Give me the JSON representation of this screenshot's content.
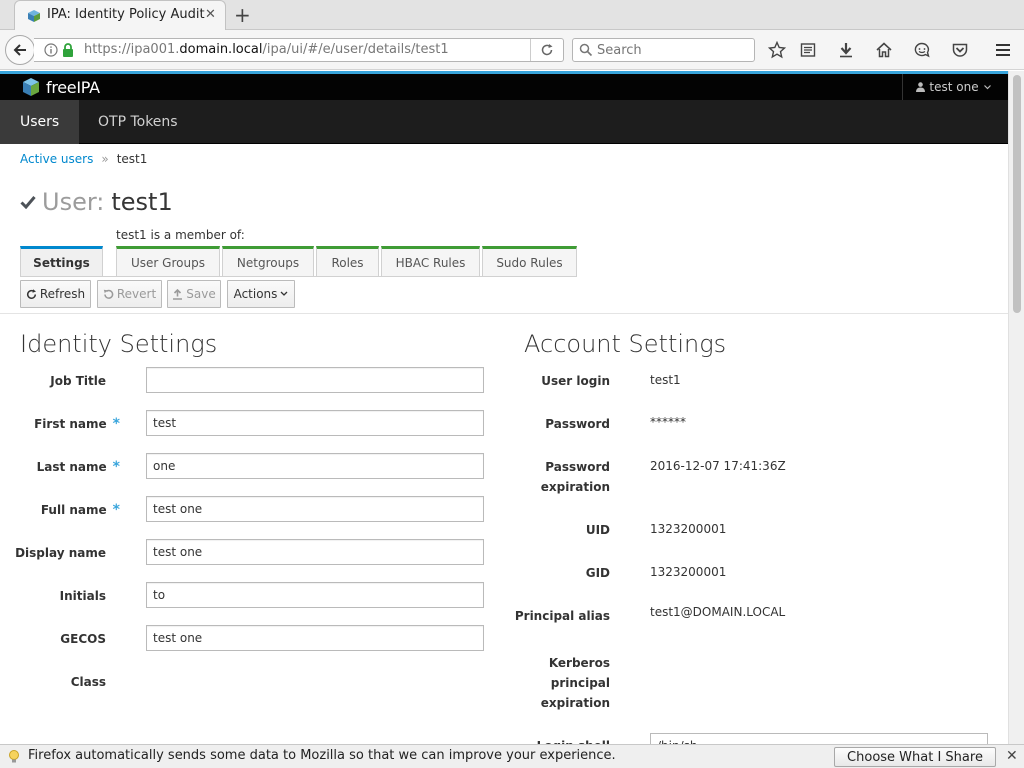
{
  "browser": {
    "tab_title": "IPA: Identity Policy Audit",
    "url_prefix": "https://ipa001.",
    "url_host": "domain.local",
    "url_path": "/ipa/ui/#/e/user/details/test1",
    "search_placeholder": "Search",
    "icons": [
      "star-icon",
      "reading-list-icon",
      "download-icon",
      "home-icon",
      "hello-icon",
      "pocket-icon",
      "menu-icon"
    ]
  },
  "app": {
    "brand": "freeIPA",
    "user_menu": "test one",
    "nav": [
      "Users",
      "OTP Tokens"
    ]
  },
  "breadcrumb": {
    "link": "Active users",
    "separator": "»",
    "current": "test1"
  },
  "title": {
    "prefix": "User:",
    "name": "test1"
  },
  "facets": {
    "member_label": "test1 is a member of:",
    "settings": "Settings",
    "tabs": [
      "User Groups",
      "Netgroups",
      "Roles",
      "HBAC Rules",
      "Sudo Rules"
    ]
  },
  "toolbar": {
    "refresh": "Refresh",
    "revert": "Revert",
    "save": "Save",
    "actions": "Actions"
  },
  "identity": {
    "title": "Identity Settings",
    "fields": [
      {
        "label": "Job Title",
        "value": "",
        "required": false
      },
      {
        "label": "First name",
        "value": "test",
        "required": true
      },
      {
        "label": "Last name",
        "value": "one",
        "required": true
      },
      {
        "label": "Full name",
        "value": "test one",
        "required": true
      },
      {
        "label": "Display name",
        "value": "test one",
        "required": false
      },
      {
        "label": "Initials",
        "value": "to",
        "required": false
      },
      {
        "label": "GECOS",
        "value": "test one",
        "required": false
      },
      {
        "label": "Class",
        "value": "",
        "required": false
      }
    ],
    "required_mark": "*"
  },
  "account": {
    "title": "Account Settings",
    "fields": [
      {
        "label": "User login",
        "value": "test1"
      },
      {
        "label": "Password",
        "value": "******"
      },
      {
        "label": "Password expiration",
        "value": "2016-12-07 17:41:36Z"
      },
      {
        "label": "UID",
        "value": "1323200001"
      },
      {
        "label": "GID",
        "value": "1323200001"
      },
      {
        "label": "Principal alias",
        "value": "test1@DOMAIN.LOCAL"
      },
      {
        "label": "Kerberos principal expiration",
        "value": ""
      },
      {
        "label": "Login shell",
        "value": "/bin/sh"
      }
    ]
  },
  "notification": {
    "text": "Firefox automatically sends some data to Mozilla so that we can improve your experience.",
    "button": "Choose What I Share"
  },
  "colors": {
    "accent": "#0088ce",
    "green": "#3f9c35",
    "blue_bar": "#39a5dc",
    "nav_dark": "#1d1d1d"
  }
}
